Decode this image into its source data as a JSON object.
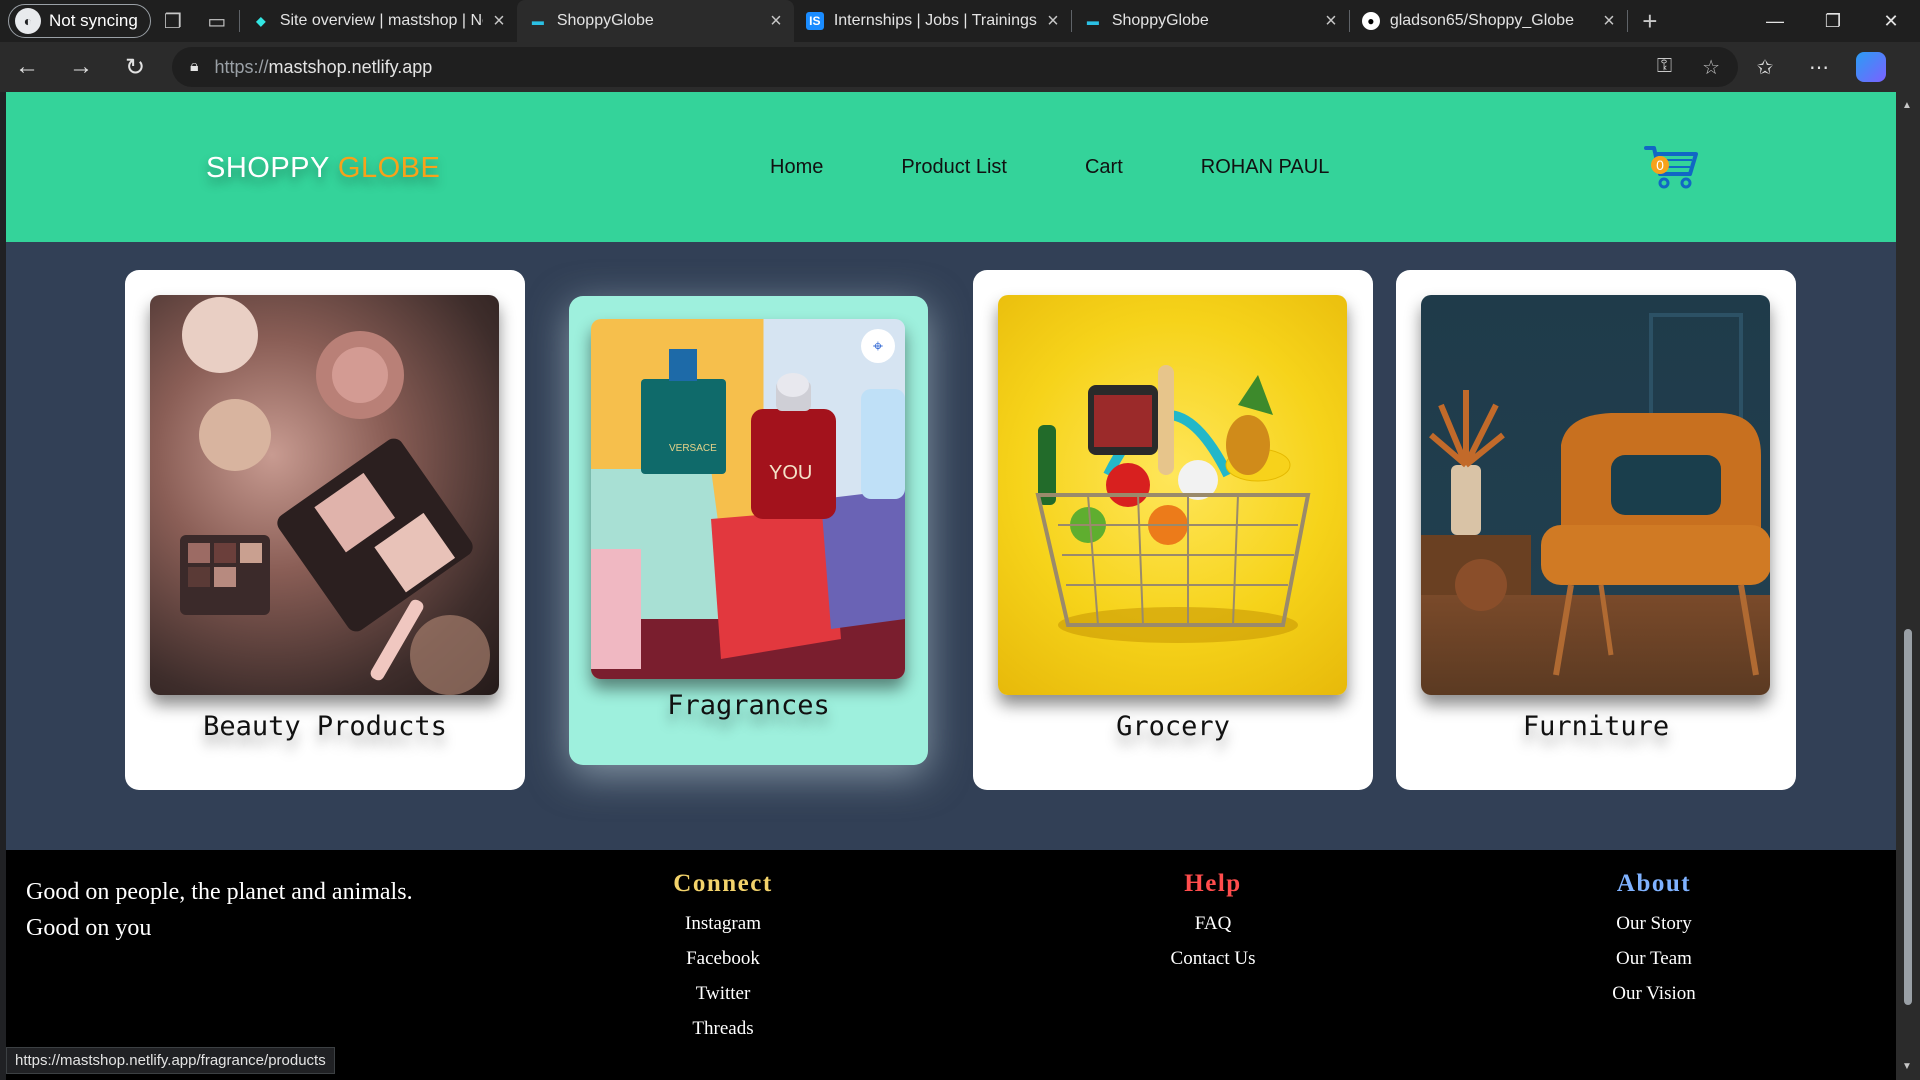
{
  "browser": {
    "profile_label": "Not syncing",
    "tabs": [
      {
        "title": "Site overview | mastshop | Netlify",
        "icon": "netlify-icon",
        "active": false
      },
      {
        "title": "ShoppyGlobe",
        "icon": "shoppyglobe-cart-icon",
        "active": true
      },
      {
        "title": "Internships | Jobs | Trainings & More",
        "icon": "internshala-icon",
        "active": false
      },
      {
        "title": "ShoppyGlobe",
        "icon": "shoppyglobe-cart-icon",
        "active": false
      },
      {
        "title": "gladson65/Shoppy_Globe",
        "icon": "github-icon",
        "active": false
      }
    ],
    "url_prefix": "https://",
    "url_host": "mastshop.netlify.app",
    "status_url": "https://mastshop.netlify.app/fragrance/products"
  },
  "site": {
    "logo_a": "SHOPPY",
    "logo_b": "GLOBE",
    "nav": [
      "Home",
      "Product List",
      "Cart",
      "ROHAN PAUL"
    ],
    "cart_count": "0",
    "colors": {
      "header": "#34d39a",
      "body": "#324056",
      "accent": "#f7a21b",
      "footer": "#000000"
    }
  },
  "categories": [
    {
      "label": "Beauty Products",
      "image": "cosmetics-flatlay"
    },
    {
      "label": "Fragrances",
      "image": "perfume-bottles",
      "highlighted": true
    },
    {
      "label": "Grocery",
      "image": "grocery-basket"
    },
    {
      "label": "Furniture",
      "image": "orange-armchair"
    }
  ],
  "footer": {
    "tagline_1": "Good on people, the planet and animals.",
    "tagline_2": "Good on you",
    "connect": {
      "title": "Connect",
      "color": "#f3d36b",
      "links": [
        "Instagram",
        "Facebook",
        "Twitter",
        "Threads"
      ]
    },
    "help": {
      "title": "Help",
      "color": "#ff4d4d",
      "links": [
        "FAQ",
        "Contact Us"
      ]
    },
    "about": {
      "title": "About",
      "color": "#7fb2ff",
      "links": [
        "Our Story",
        "Our Team",
        "Our Vision"
      ]
    }
  }
}
